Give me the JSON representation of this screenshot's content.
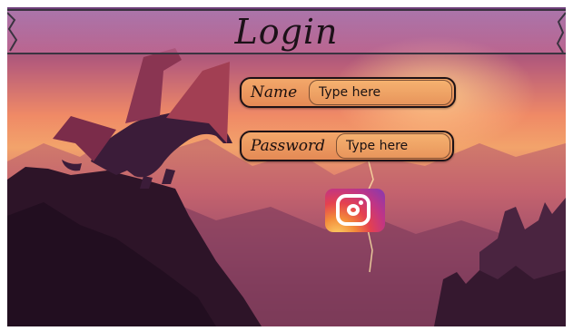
{
  "header": {
    "title": "Login"
  },
  "form": {
    "name": {
      "label": "Name",
      "placeholder": "Type here"
    },
    "password": {
      "label": "Password",
      "placeholder": "Type here"
    }
  },
  "social": {
    "icon": "instagram-icon"
  },
  "colors": {
    "field_fill": "#f3a86a",
    "field_border": "#1d1216",
    "banner_fill": "#d98ac0"
  }
}
